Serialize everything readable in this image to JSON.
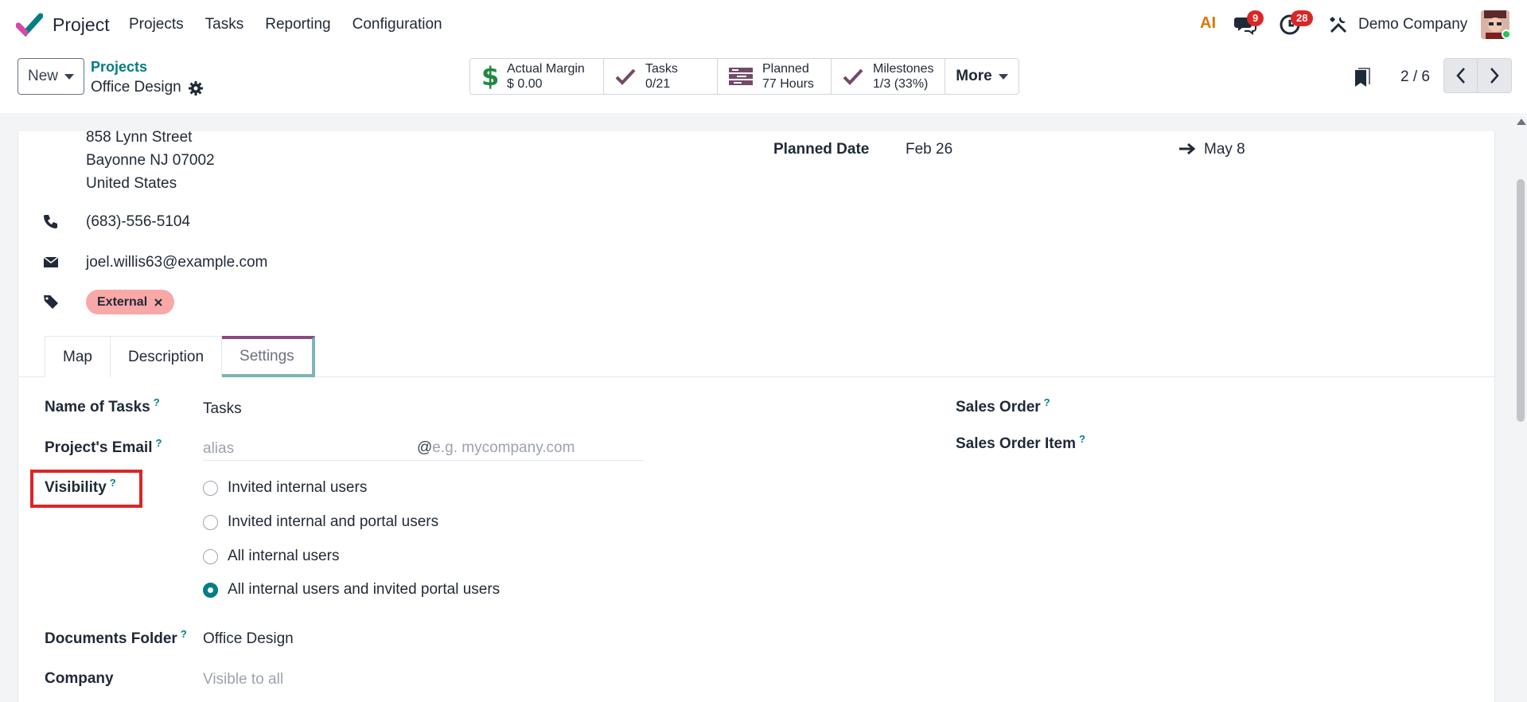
{
  "navbar": {
    "app_name": "Project",
    "menu": [
      "Projects",
      "Tasks",
      "Reporting",
      "Configuration"
    ],
    "ai_label": "AI",
    "messages_count": "9",
    "activities_count": "28",
    "company": "Demo Company"
  },
  "control": {
    "new_label": "New",
    "breadcrumb_parent": "Projects",
    "breadcrumb_current": "Office Design",
    "stats": [
      {
        "label": "Actual Margin",
        "value": "$ 0.00",
        "icon": "dollar-icon"
      },
      {
        "label": "Tasks",
        "value": "0/21",
        "icon": "check-icon"
      },
      {
        "label": "Planned",
        "value": "77 Hours",
        "icon": "planning-icon"
      },
      {
        "label": "Milestones",
        "value": "1/3 (33%)",
        "icon": "check-icon"
      }
    ],
    "more_label": "More",
    "pager": "2 / 6"
  },
  "record": {
    "address": [
      "858 Lynn Street",
      "Bayonne NJ 07002",
      "United States"
    ],
    "phone": "(683)-556-5104",
    "email": "joel.willis63@example.com",
    "tag": "External",
    "planned_date_label": "Planned Date",
    "planned_start": "Feb 26",
    "planned_end": "May 8"
  },
  "tabs": [
    "Map",
    "Description",
    "Settings"
  ],
  "settings": {
    "name_of_tasks_label": "Name of Tasks",
    "name_of_tasks_value": "Tasks",
    "project_email_label": "Project's Email",
    "alias_placeholder": "alias",
    "domain_at": "@",
    "domain_placeholder": "e.g. mycompany.com",
    "visibility_label": "Visibility",
    "visibility_options": [
      "Invited internal users",
      "Invited internal and portal users",
      "All internal users",
      "All internal users and invited portal users"
    ],
    "visibility_selected": 3,
    "documents_folder_label": "Documents Folder",
    "documents_folder_value": "Office Design",
    "company_label": "Company",
    "company_placeholder": "Visible to all",
    "sales_order_label": "Sales Order",
    "sales_order_item_label": "Sales Order Item",
    "help_mark": "?"
  },
  "colors": {
    "accent": "#017e84",
    "brand": "#714b67",
    "badge": "#dc2626",
    "tag": "#f9a8a8",
    "highlight": "#dc2626"
  }
}
